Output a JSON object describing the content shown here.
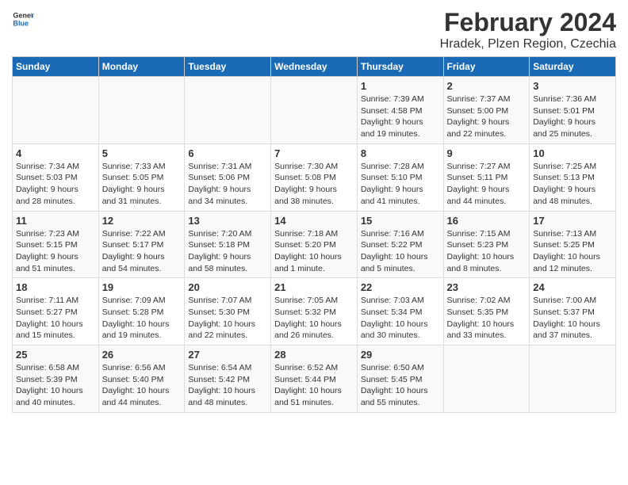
{
  "header": {
    "logo_general": "General",
    "logo_blue": "Blue",
    "title": "February 2024",
    "subtitle": "Hradek, Plzen Region, Czechia"
  },
  "calendar": {
    "days_of_week": [
      "Sunday",
      "Monday",
      "Tuesday",
      "Wednesday",
      "Thursday",
      "Friday",
      "Saturday"
    ],
    "weeks": [
      {
        "cells": [
          {
            "day": "",
            "content": ""
          },
          {
            "day": "",
            "content": ""
          },
          {
            "day": "",
            "content": ""
          },
          {
            "day": "",
            "content": ""
          },
          {
            "day": "1",
            "content": "Sunrise: 7:39 AM\nSunset: 4:58 PM\nDaylight: 9 hours\nand 19 minutes."
          },
          {
            "day": "2",
            "content": "Sunrise: 7:37 AM\nSunset: 5:00 PM\nDaylight: 9 hours\nand 22 minutes."
          },
          {
            "day": "3",
            "content": "Sunrise: 7:36 AM\nSunset: 5:01 PM\nDaylight: 9 hours\nand 25 minutes."
          }
        ]
      },
      {
        "cells": [
          {
            "day": "4",
            "content": "Sunrise: 7:34 AM\nSunset: 5:03 PM\nDaylight: 9 hours\nand 28 minutes."
          },
          {
            "day": "5",
            "content": "Sunrise: 7:33 AM\nSunset: 5:05 PM\nDaylight: 9 hours\nand 31 minutes."
          },
          {
            "day": "6",
            "content": "Sunrise: 7:31 AM\nSunset: 5:06 PM\nDaylight: 9 hours\nand 34 minutes."
          },
          {
            "day": "7",
            "content": "Sunrise: 7:30 AM\nSunset: 5:08 PM\nDaylight: 9 hours\nand 38 minutes."
          },
          {
            "day": "8",
            "content": "Sunrise: 7:28 AM\nSunset: 5:10 PM\nDaylight: 9 hours\nand 41 minutes."
          },
          {
            "day": "9",
            "content": "Sunrise: 7:27 AM\nSunset: 5:11 PM\nDaylight: 9 hours\nand 44 minutes."
          },
          {
            "day": "10",
            "content": "Sunrise: 7:25 AM\nSunset: 5:13 PM\nDaylight: 9 hours\nand 48 minutes."
          }
        ]
      },
      {
        "cells": [
          {
            "day": "11",
            "content": "Sunrise: 7:23 AM\nSunset: 5:15 PM\nDaylight: 9 hours\nand 51 minutes."
          },
          {
            "day": "12",
            "content": "Sunrise: 7:22 AM\nSunset: 5:17 PM\nDaylight: 9 hours\nand 54 minutes."
          },
          {
            "day": "13",
            "content": "Sunrise: 7:20 AM\nSunset: 5:18 PM\nDaylight: 9 hours\nand 58 minutes."
          },
          {
            "day": "14",
            "content": "Sunrise: 7:18 AM\nSunset: 5:20 PM\nDaylight: 10 hours\nand 1 minute."
          },
          {
            "day": "15",
            "content": "Sunrise: 7:16 AM\nSunset: 5:22 PM\nDaylight: 10 hours\nand 5 minutes."
          },
          {
            "day": "16",
            "content": "Sunrise: 7:15 AM\nSunset: 5:23 PM\nDaylight: 10 hours\nand 8 minutes."
          },
          {
            "day": "17",
            "content": "Sunrise: 7:13 AM\nSunset: 5:25 PM\nDaylight: 10 hours\nand 12 minutes."
          }
        ]
      },
      {
        "cells": [
          {
            "day": "18",
            "content": "Sunrise: 7:11 AM\nSunset: 5:27 PM\nDaylight: 10 hours\nand 15 minutes."
          },
          {
            "day": "19",
            "content": "Sunrise: 7:09 AM\nSunset: 5:28 PM\nDaylight: 10 hours\nand 19 minutes."
          },
          {
            "day": "20",
            "content": "Sunrise: 7:07 AM\nSunset: 5:30 PM\nDaylight: 10 hours\nand 22 minutes."
          },
          {
            "day": "21",
            "content": "Sunrise: 7:05 AM\nSunset: 5:32 PM\nDaylight: 10 hours\nand 26 minutes."
          },
          {
            "day": "22",
            "content": "Sunrise: 7:03 AM\nSunset: 5:34 PM\nDaylight: 10 hours\nand 30 minutes."
          },
          {
            "day": "23",
            "content": "Sunrise: 7:02 AM\nSunset: 5:35 PM\nDaylight: 10 hours\nand 33 minutes."
          },
          {
            "day": "24",
            "content": "Sunrise: 7:00 AM\nSunset: 5:37 PM\nDaylight: 10 hours\nand 37 minutes."
          }
        ]
      },
      {
        "cells": [
          {
            "day": "25",
            "content": "Sunrise: 6:58 AM\nSunset: 5:39 PM\nDaylight: 10 hours\nand 40 minutes."
          },
          {
            "day": "26",
            "content": "Sunrise: 6:56 AM\nSunset: 5:40 PM\nDaylight: 10 hours\nand 44 minutes."
          },
          {
            "day": "27",
            "content": "Sunrise: 6:54 AM\nSunset: 5:42 PM\nDaylight: 10 hours\nand 48 minutes."
          },
          {
            "day": "28",
            "content": "Sunrise: 6:52 AM\nSunset: 5:44 PM\nDaylight: 10 hours\nand 51 minutes."
          },
          {
            "day": "29",
            "content": "Sunrise: 6:50 AM\nSunset: 5:45 PM\nDaylight: 10 hours\nand 55 minutes."
          },
          {
            "day": "",
            "content": ""
          },
          {
            "day": "",
            "content": ""
          }
        ]
      }
    ]
  }
}
